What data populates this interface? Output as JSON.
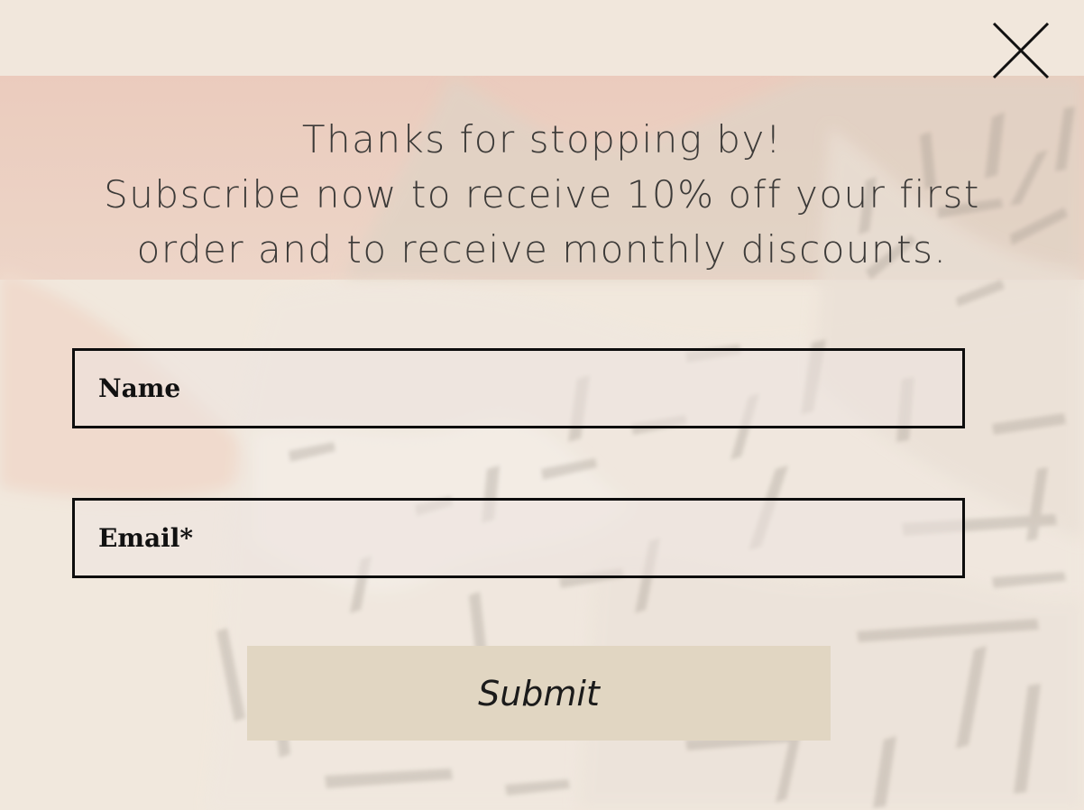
{
  "popup": {
    "headline_line1": "Thanks for stopping by!",
    "headline_line2": "Subscribe now to receive 10% off your first",
    "headline_line3": "order and to receive monthly discounts.",
    "name_placeholder": "Name",
    "email_placeholder": "Email*",
    "submit_label": "Submit",
    "close_icon": "close-x-icon"
  },
  "colors": {
    "background": "#f1e7dc",
    "pink_band": "#e8c6b8",
    "button": "#e1d6c2",
    "field_border": "#0d0d0d",
    "text": "#3c3a38"
  }
}
